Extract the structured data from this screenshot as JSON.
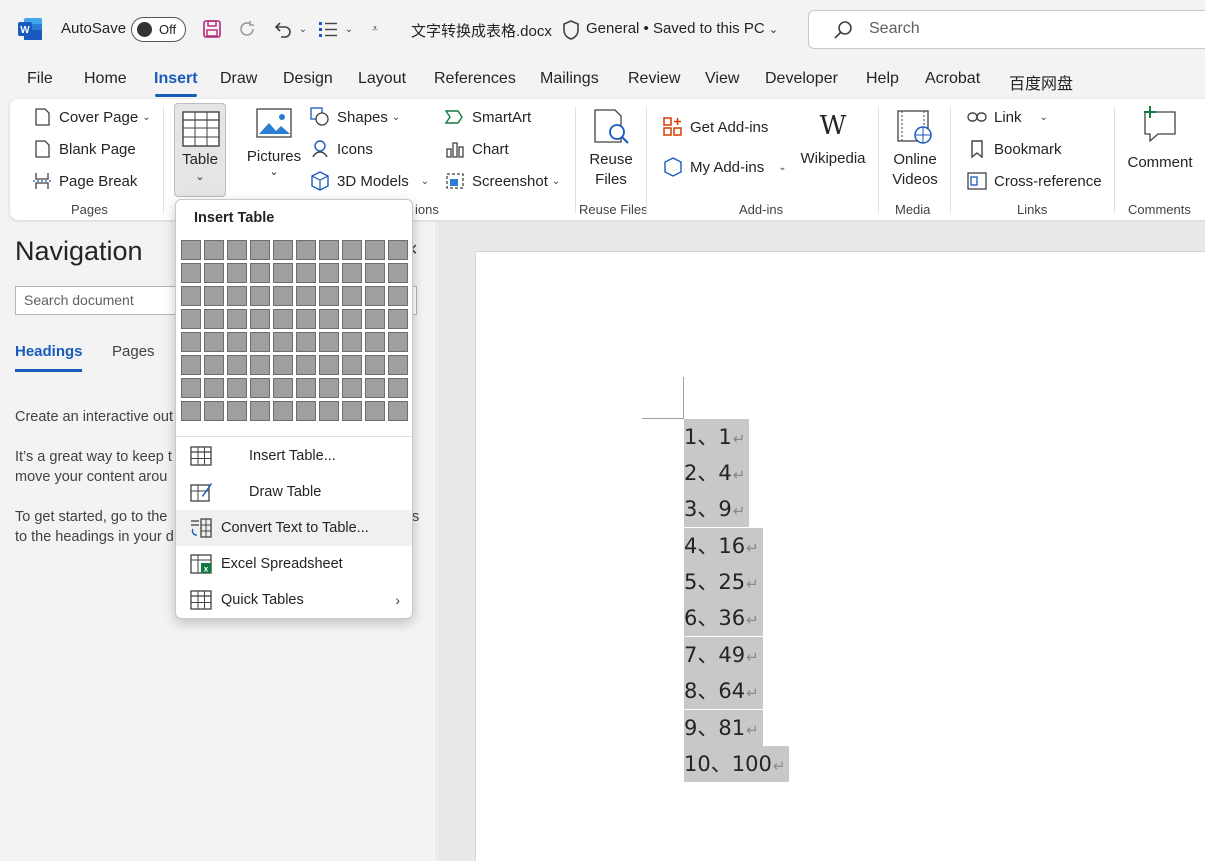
{
  "titlebar": {
    "autosave_label": "AutoSave",
    "toggle_state": "Off",
    "doc_title": "文字转换成表格.docx",
    "save_state": "General • Saved to this PC",
    "search_placeholder": "Search"
  },
  "tabs": [
    "File",
    "Home",
    "Insert",
    "Draw",
    "Design",
    "Layout",
    "References",
    "Mailings",
    "Review",
    "View",
    "Developer",
    "Help",
    "Acrobat",
    "百度网盘"
  ],
  "active_tab": "Insert",
  "ribbon": {
    "pages": {
      "cover": "Cover Page",
      "blank": "Blank Page",
      "break": "Page Break",
      "label": "Pages"
    },
    "table": {
      "label": "Table"
    },
    "pictures": {
      "label": "Pictures"
    },
    "illustrations": {
      "shapes": "Shapes",
      "icons": "Icons",
      "models": "3D Models",
      "smartart": "SmartArt",
      "chart": "Chart",
      "screenshot": "Screenshot",
      "label_partial": "ions"
    },
    "reuse": {
      "line1": "Reuse",
      "line2": "Files",
      "label": "Reuse Files"
    },
    "addins": {
      "get": "Get Add-ins",
      "my": "My Add-ins",
      "wikipedia": "Wikipedia",
      "label": "Add-ins"
    },
    "media": {
      "line1": "Online",
      "line2": "Videos",
      "label": "Media"
    },
    "links": {
      "link": "Link",
      "bookmark": "Bookmark",
      "crossref": "Cross-reference",
      "label": "Links"
    },
    "comments": {
      "comment": "Comment",
      "label": "Comments"
    }
  },
  "nav": {
    "title": "Navigation",
    "search_placeholder": "Search document",
    "tab_headings": "Headings",
    "tab_pages": "Pages",
    "p1": "Create an interactive out",
    "p2a": "It’s a great way to keep t",
    "p2b": "move your content arou",
    "p3a": "To get started, go to the",
    "p3b": "to the headings in your d",
    "p3_tail": "s"
  },
  "dropdown": {
    "header": "Insert Table",
    "items": [
      {
        "label": "Insert Table..."
      },
      {
        "label": "Draw Table"
      },
      {
        "label": "Convert Text to Table..."
      },
      {
        "label": "Excel Spreadsheet"
      },
      {
        "label": "Quick Tables"
      }
    ]
  },
  "document": {
    "lines": [
      "1、1",
      "2、4",
      "3、9",
      "4、16",
      "5、25",
      "6、36",
      "7、49",
      "8、64",
      "9、81",
      "10、100"
    ],
    "para_mark": "↵"
  },
  "colors": {
    "accent": "#185abd",
    "word_blue": "#185abd",
    "highlight": "#c8c8c8"
  }
}
